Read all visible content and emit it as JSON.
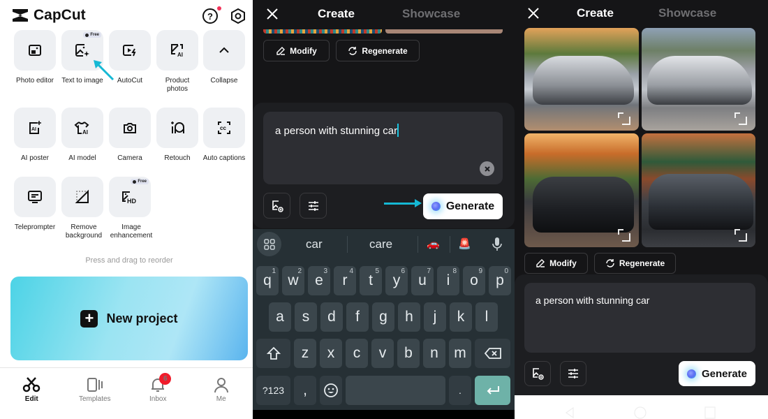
{
  "panel_home": {
    "app_name": "CapCut",
    "header_icons": [
      "help-icon",
      "settings-icon"
    ],
    "tools": [
      {
        "label": "Photo editor",
        "icon": "photo-editor-icon",
        "free": false
      },
      {
        "label": "Text to image",
        "icon": "text-to-image-icon",
        "free": true
      },
      {
        "label": "AutoCut",
        "icon": "autocut-icon",
        "free": false
      },
      {
        "label": "Product photos",
        "icon": "product-photos-icon",
        "free": false
      },
      {
        "label": "Collapse",
        "icon": "chevron-up-icon",
        "free": false
      },
      {
        "label": "AI poster",
        "icon": "ai-poster-icon",
        "free": false
      },
      {
        "label": "AI model",
        "icon": "ai-model-icon",
        "free": false
      },
      {
        "label": "Camera",
        "icon": "camera-icon",
        "free": false
      },
      {
        "label": "Retouch",
        "icon": "retouch-icon",
        "free": false
      },
      {
        "label": "Auto captions",
        "icon": "captions-icon",
        "free": false
      },
      {
        "label": "Teleprompter",
        "icon": "teleprompter-icon",
        "free": false
      },
      {
        "label": "Remove background",
        "icon": "remove-background-icon",
        "free": false
      },
      {
        "label": "Image enhancement",
        "icon": "image-hd-icon",
        "free": true
      }
    ],
    "free_badge": "Free",
    "reorder_hint": "Press and drag to reorder",
    "new_project_label": "New project",
    "bottom_nav": [
      {
        "label": "Edit",
        "icon": "scissors-icon",
        "active": true
      },
      {
        "label": "Templates",
        "icon": "templates-icon",
        "active": false
      },
      {
        "label": "Inbox",
        "icon": "bell-icon",
        "active": false,
        "badge": "6"
      },
      {
        "label": "Me",
        "icon": "person-icon",
        "active": false
      }
    ],
    "annotation_arrow_color": "#15b8d4"
  },
  "panel_prompt": {
    "tabs": {
      "create": "Create",
      "showcase": "Showcase"
    },
    "modify_label": "Modify",
    "regenerate_label": "Regenerate",
    "prompt_value": "a person with stunning car",
    "generate_label": "Generate",
    "keyboard": {
      "suggestions": [
        "car",
        "care"
      ],
      "suggestion_emojis": [
        "🚗",
        "🚨"
      ],
      "row1": [
        "q",
        "w",
        "e",
        "r",
        "t",
        "y",
        "u",
        "i",
        "o",
        "p"
      ],
      "row1_nums": [
        "1",
        "2",
        "3",
        "4",
        "5",
        "6",
        "7",
        "8",
        "9",
        "0"
      ],
      "row2": [
        "a",
        "s",
        "d",
        "f",
        "g",
        "h",
        "j",
        "k",
        "l"
      ],
      "row3": [
        "z",
        "x",
        "c",
        "v",
        "b",
        "n",
        "m"
      ],
      "symbols_label": "?123",
      "comma": ",",
      "period": "."
    }
  },
  "panel_results": {
    "tabs": {
      "create": "Create",
      "showcase": "Showcase"
    },
    "images": [
      {
        "alt": "Silver sports car on brick road with trees"
      },
      {
        "alt": "Silver sports car with palm trees and mountains"
      },
      {
        "alt": "Black BMW sports car with autumn trees"
      },
      {
        "alt": "Dark grey supercar with person and building"
      }
    ],
    "modify_label": "Modify",
    "regenerate_label": "Regenerate",
    "prompt_value": "a person with stunning car",
    "generate_label": "Generate"
  }
}
